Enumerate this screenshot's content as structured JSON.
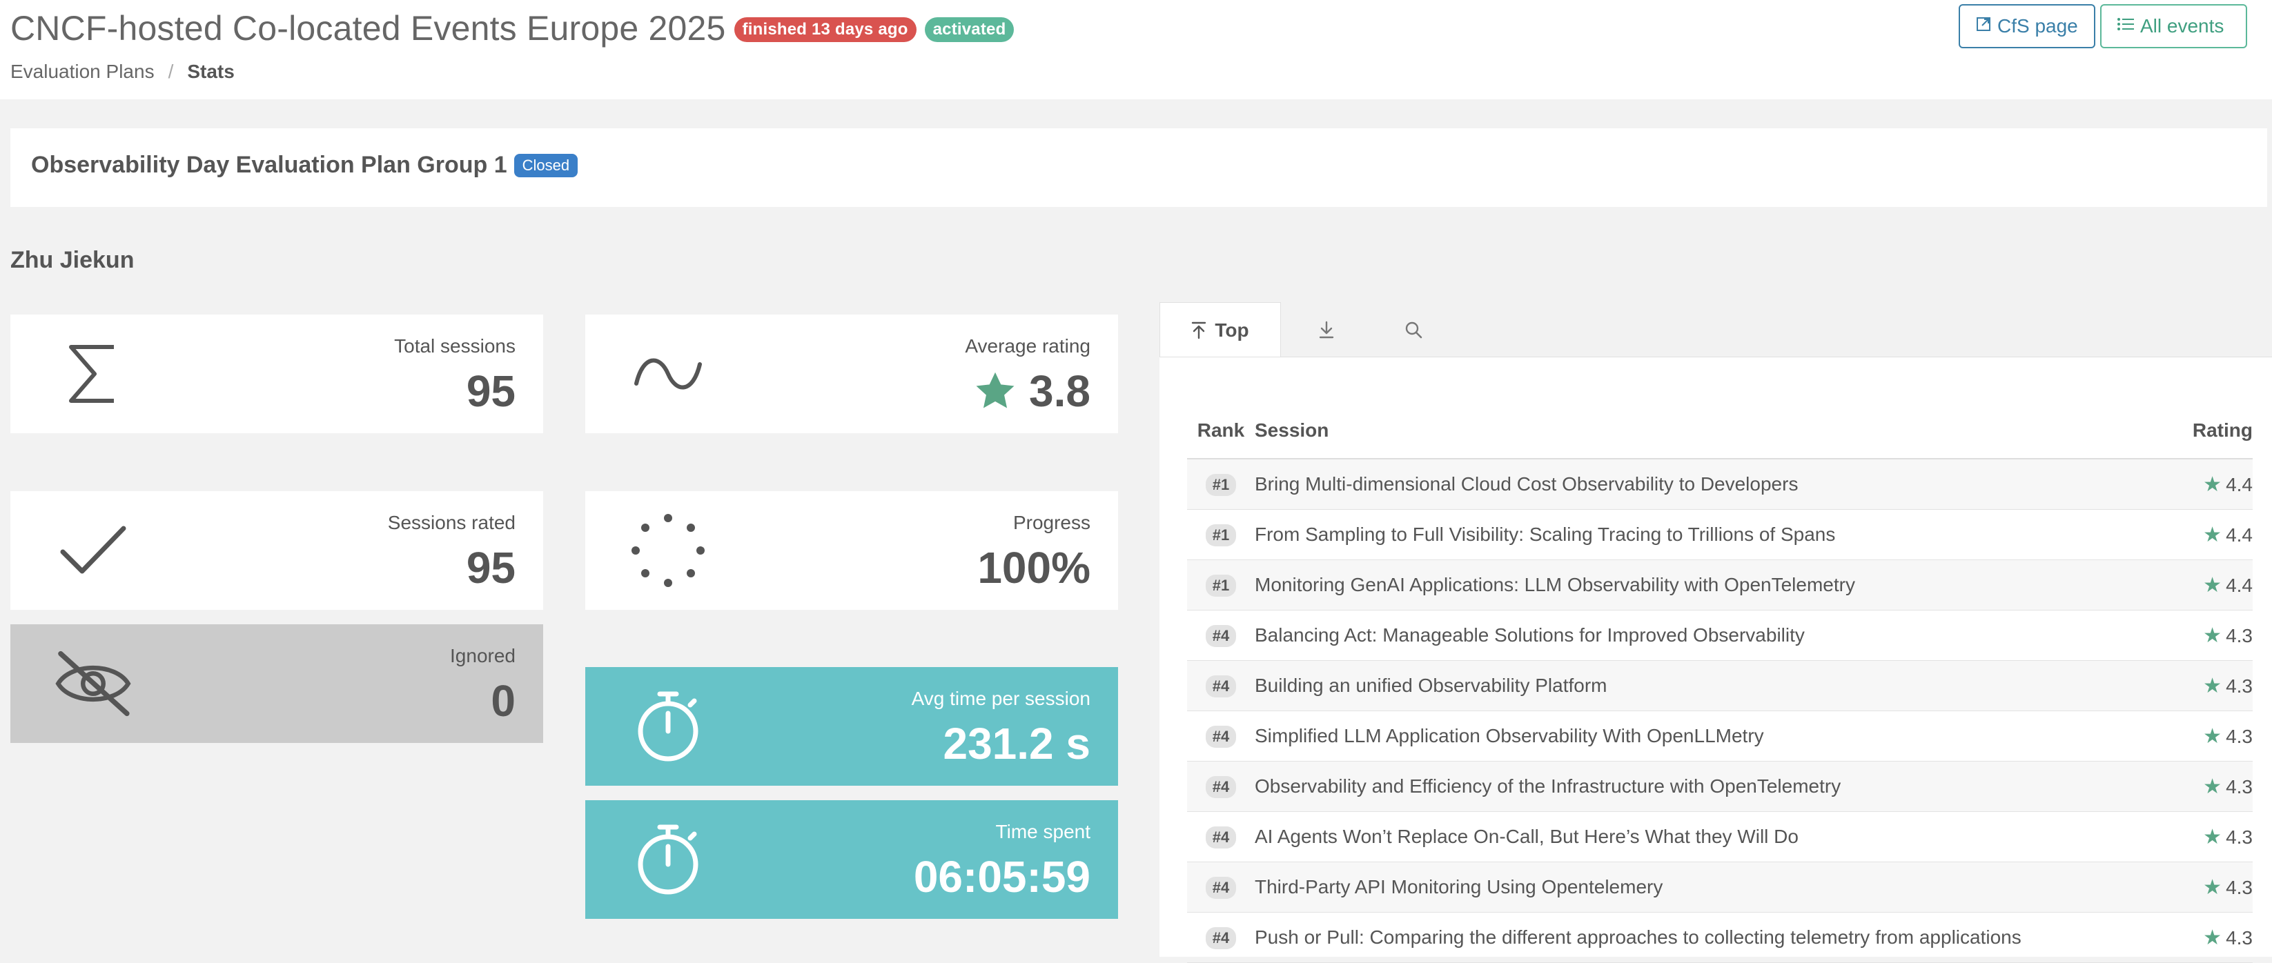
{
  "header": {
    "event_title": "CNCF-hosted Co-located Events Europe 2025",
    "badge_finished": "finished 13 days ago",
    "badge_activated": "activated",
    "cfs_button": "CfS page",
    "all_events_button": "All events",
    "breadcrumb": {
      "parent": "Evaluation Plans",
      "separator": "/",
      "current": "Stats"
    }
  },
  "plan": {
    "title": "Observability Day Evaluation Plan Group 1",
    "status": "Closed"
  },
  "reviewer": "Zhu Jiekun",
  "stats": {
    "total_sessions": {
      "label": "Total sessions",
      "value": "95"
    },
    "average_rating": {
      "label": "Average rating",
      "value": "3.8"
    },
    "sessions_rated": {
      "label": "Sessions rated",
      "value": "95"
    },
    "progress": {
      "label": "Progress",
      "value": "100%"
    },
    "ignored": {
      "label": "Ignored",
      "value": "0"
    },
    "avg_time": {
      "label": "Avg time per session",
      "value": "231.2 s"
    },
    "time_spent": {
      "label": "Time spent",
      "value": "06:05:59"
    }
  },
  "tabs": [
    {
      "label": "Top",
      "icon": "arrow-up-to-line-icon"
    },
    {
      "label": "",
      "icon": "download-icon"
    },
    {
      "label": "",
      "icon": "search-icon"
    }
  ],
  "table": {
    "headers": {
      "rank": "Rank",
      "session": "Session",
      "rating": "Rating"
    },
    "rows": [
      {
        "rank": "#1",
        "session": "Bring Multi-dimensional Cloud Cost Observability to Developers",
        "rating": "4.4"
      },
      {
        "rank": "#1",
        "session": "From Sampling to Full Visibility: Scaling Tracing to Trillions of Spans",
        "rating": "4.4"
      },
      {
        "rank": "#1",
        "session": "Monitoring GenAI Applications: LLM Observability with OpenTelemetry",
        "rating": "4.4"
      },
      {
        "rank": "#4",
        "session": "Balancing Act: Manageable Solutions for Improved Observability",
        "rating": "4.3"
      },
      {
        "rank": "#4",
        "session": "Building an unified Observability Platform",
        "rating": "4.3"
      },
      {
        "rank": "#4",
        "session": "Simplified LLM Application Observability With OpenLLMetry",
        "rating": "4.3"
      },
      {
        "rank": "#4",
        "session": "Observability and Efficiency of the Infrastructure with OpenTelemetry",
        "rating": "4.3"
      },
      {
        "rank": "#4",
        "session": "AI Agents Won’t Replace On-Call, But Here’s What they Will Do",
        "rating": "4.3"
      },
      {
        "rank": "#4",
        "session": "Third-Party API Monitoring Using Opentelemery",
        "rating": "4.3"
      },
      {
        "rank": "#4",
        "session": "Push or Pull: Comparing the different approaches to collecting telemetry from applications",
        "rating": "4.3"
      }
    ]
  },
  "colors": {
    "accent_teal": "#67c3c8",
    "star_green": "#5aa585",
    "badge_red": "#d9534f",
    "badge_green": "#5cb89a",
    "badge_blue": "#3a7fc8"
  }
}
